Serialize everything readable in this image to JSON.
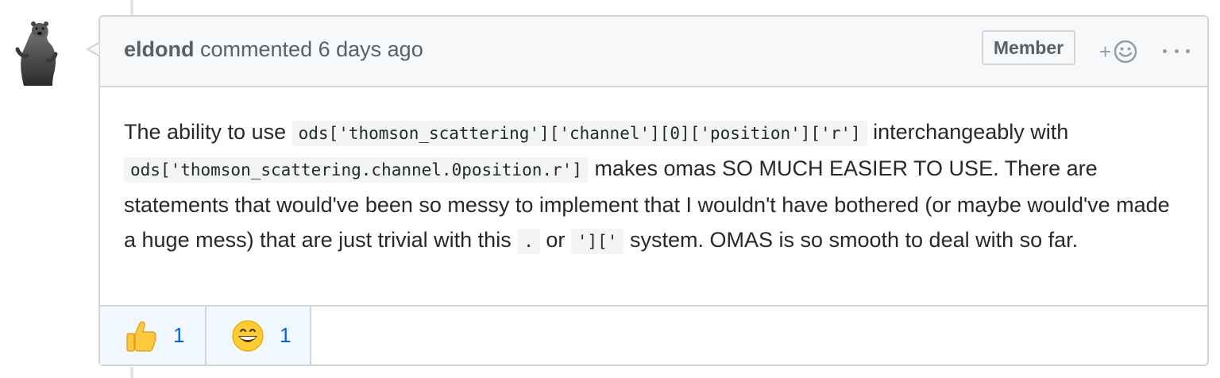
{
  "comment": {
    "author": "eldond",
    "action": "commented",
    "time": "6 days ago",
    "badge": "Member",
    "add_reaction_label": "+",
    "body": {
      "t1": "The ability to use ",
      "code1": "ods['thomson_scattering']['channel'][0]['position']['r']",
      "t2": " interchangeably with ",
      "code2": "ods['thomson_scattering.channel.0position.r']",
      "t3": " makes omas SO MUCH EASIER TO USE. There are statements that would've been so messy to implement that I wouldn't have bothered (or maybe would've made a huge mess) that are just trivial with this ",
      "code3": ".",
      "t4": " or ",
      "code4": "']['",
      "t5": " system. OMAS is so smooth to deal with so far."
    },
    "reactions": [
      {
        "icon": "thumbs-up-icon",
        "count": "1"
      },
      {
        "icon": "grinning-face-icon",
        "count": "1"
      }
    ]
  },
  "colors": {
    "border": "#d1d5da",
    "header_bg": "#f6f8fa",
    "reaction_bg": "#f1f8ff",
    "link": "#0366d6"
  }
}
